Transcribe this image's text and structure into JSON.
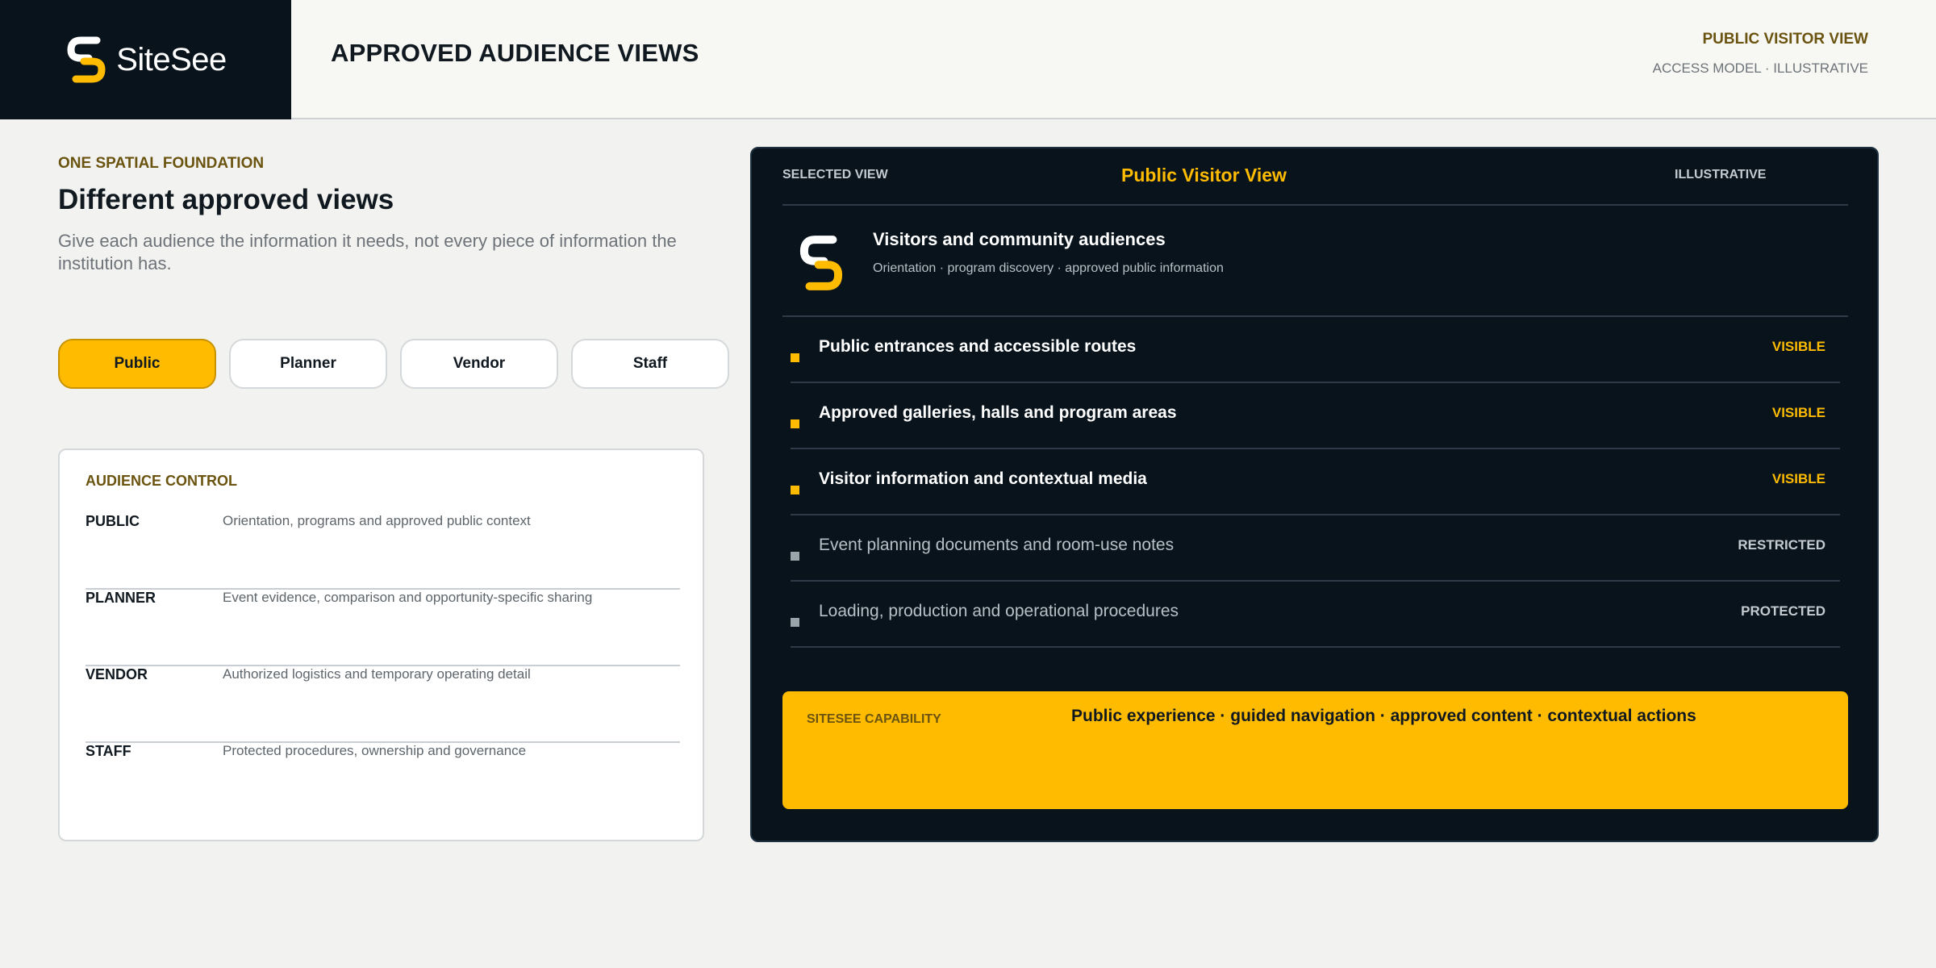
{
  "header": {
    "brand": "SiteSee",
    "title": "APPROVED AUDIENCE VIEWS",
    "right_title": "PUBLIC VISITOR VIEW",
    "right_sub": "ACCESS MODEL · ILLUSTRATIVE"
  },
  "intro": {
    "eyebrow": "ONE SPATIAL FOUNDATION",
    "title": "Different approved views",
    "description": "Give each audience the information it needs, not every piece of information the institution has."
  },
  "audience_tabs": [
    {
      "label": "Public",
      "active": true
    },
    {
      "label": "Planner",
      "active": false
    },
    {
      "label": "Vendor",
      "active": false
    },
    {
      "label": "Staff",
      "active": false
    }
  ],
  "audience_control": {
    "eyebrow": "AUDIENCE CONTROL",
    "rows": [
      {
        "name": "PUBLIC",
        "desc": "Orientation, programs and approved public context"
      },
      {
        "name": "PLANNER",
        "desc": "Event evidence, comparison and opportunity-specific sharing"
      },
      {
        "name": "VENDOR",
        "desc": "Authorized logistics and temporary operating detail"
      },
      {
        "name": "STAFF",
        "desc": "Protected procedures, ownership and governance"
      }
    ]
  },
  "selected_view": {
    "label": "SELECTED VIEW",
    "title": "Public Visitor View",
    "tag": "ILLUSTRATIVE",
    "audience_title": "Visitors and community audiences",
    "audience_sub": "Orientation · program discovery · approved public information",
    "items": [
      {
        "label": "Public entrances and accessible routes",
        "status": "VISIBLE",
        "visible": true
      },
      {
        "label": "Approved galleries, halls and program areas",
        "status": "VISIBLE",
        "visible": true
      },
      {
        "label": "Visitor information and contextual media",
        "status": "VISIBLE",
        "visible": true
      },
      {
        "label": "Event planning documents and room-use notes",
        "status": "RESTRICTED",
        "visible": false
      },
      {
        "label": "Loading, production and operational procedures",
        "status": "PROTECTED",
        "visible": false
      }
    ],
    "capability_label": "SITESEE CAPABILITY",
    "capability_text": "Public experience · guided navigation · approved content · contextual actions"
  },
  "colors": {
    "accent": "#ffbb00",
    "dark": "#08131c",
    "eyebrow": "#6b5410"
  },
  "icons": {
    "brand": "sitesee-logo-icon"
  }
}
